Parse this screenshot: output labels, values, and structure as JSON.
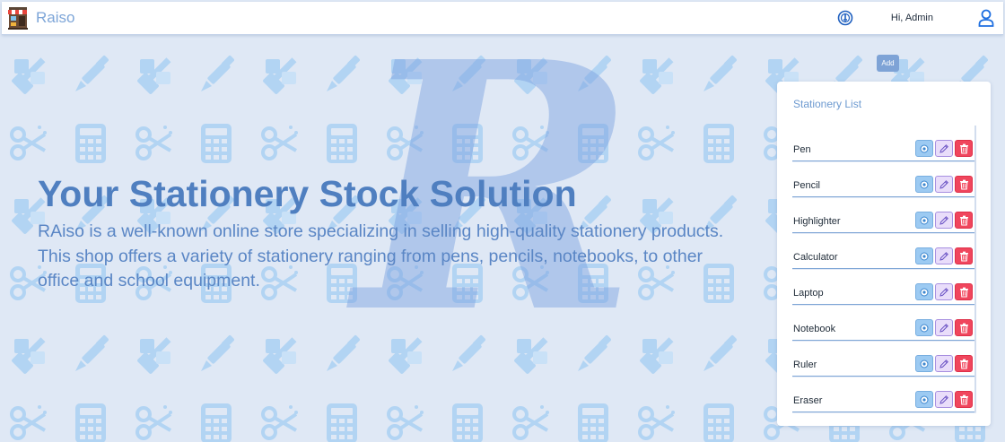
{
  "navbar": {
    "brand_name": "Raiso",
    "greeting": "Hi, Admin"
  },
  "hero": {
    "title": "Your Stationery Stock Solution",
    "description": "RAiso is a well-known online store specializing in selling high-quality stationery products. This shop offers a variety of stationery ranging from pens, pencils, notebooks, to other office and school equipment."
  },
  "watermark_letter": "R",
  "add_button_label": "Add",
  "stationery": {
    "title": "Stationery List",
    "items": [
      {
        "name": "Pen"
      },
      {
        "name": "Pencil"
      },
      {
        "name": "Highlighter"
      },
      {
        "name": "Calculator"
      },
      {
        "name": "Laptop"
      },
      {
        "name": "Notebook"
      },
      {
        "name": "Ruler"
      },
      {
        "name": "Eraser"
      }
    ],
    "row_actions": [
      "view-icon",
      "edit-pencil-icon",
      "trash-icon"
    ]
  },
  "icons": {
    "brand": "storefront-icon",
    "notification": "notification-bell-icon",
    "user": "user-icon",
    "background": [
      "pencil-ruler-icon",
      "pen-icon",
      "scissors-icon",
      "calculator-icon"
    ]
  },
  "colors": {
    "background": "#dfe8f5",
    "accent": "#4f7fc0",
    "brand_text": "#7ea6d8",
    "view_button": "#9ccaf2",
    "edit_button": "#e9ddfa",
    "delete_button": "#f0465d",
    "pattern_icon": "#b2d4f3"
  }
}
